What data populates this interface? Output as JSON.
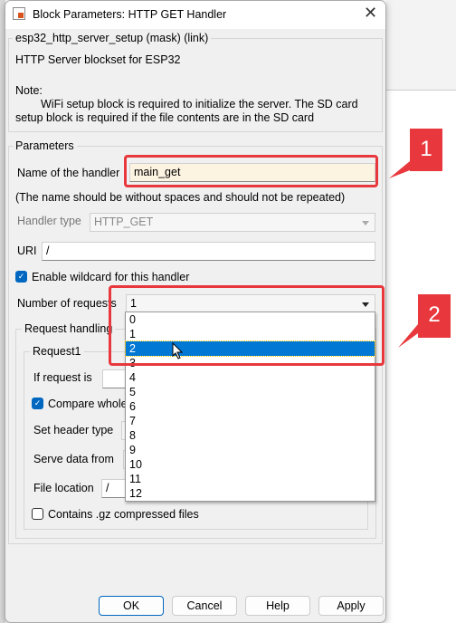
{
  "window": {
    "title": "Block Parameters: HTTP GET Handler"
  },
  "mask": {
    "legend": "esp32_http_server_setup (mask) (link)",
    "description": "HTTP Server blockset for ESP32",
    "note_label": "Note:",
    "note_line1": "WiFi setup block is required to initialize the server. The SD card",
    "note_line2": "setup block is required if the file contents are in the SD card"
  },
  "parameters": {
    "legend": "Parameters",
    "handler_name_label": "Name of the handler",
    "handler_name_value": "main_get",
    "handler_name_hint": "(The name should be without spaces and should not be repeated)",
    "handler_type_label": "Handler type",
    "handler_type_value": "HTTP_GET",
    "uri_label": "URI",
    "uri_value": "/",
    "wildcard_label": "Enable wildcard for this handler",
    "wildcard_checked": true,
    "num_requests_label": "Number of requests",
    "num_requests_value": "1",
    "num_requests_options": [
      "0",
      "1",
      "2",
      "3",
      "4",
      "5",
      "6",
      "7",
      "8",
      "9",
      "10",
      "11",
      "12"
    ],
    "num_requests_highlighted": "2"
  },
  "request_handling": {
    "legend": "Request handling",
    "request1": {
      "legend": "Request1",
      "if_request_label": "If request is",
      "compare_label": "Compare whole",
      "compare_checked": true,
      "header_type_label": "Set header type",
      "serve_from_label": "Serve data from",
      "file_location_label": "File location",
      "file_location_value": "/",
      "gz_label": "Contains .gz compressed files",
      "gz_checked": false
    }
  },
  "buttons": {
    "ok": "OK",
    "cancel": "Cancel",
    "help": "Help",
    "apply": "Apply"
  },
  "annotations": {
    "callout1": "1",
    "callout2": "2"
  },
  "colors": {
    "accent": "#0067c0",
    "highlight_box": "#e8383d",
    "name_field_bg": "#fdf3e1"
  }
}
